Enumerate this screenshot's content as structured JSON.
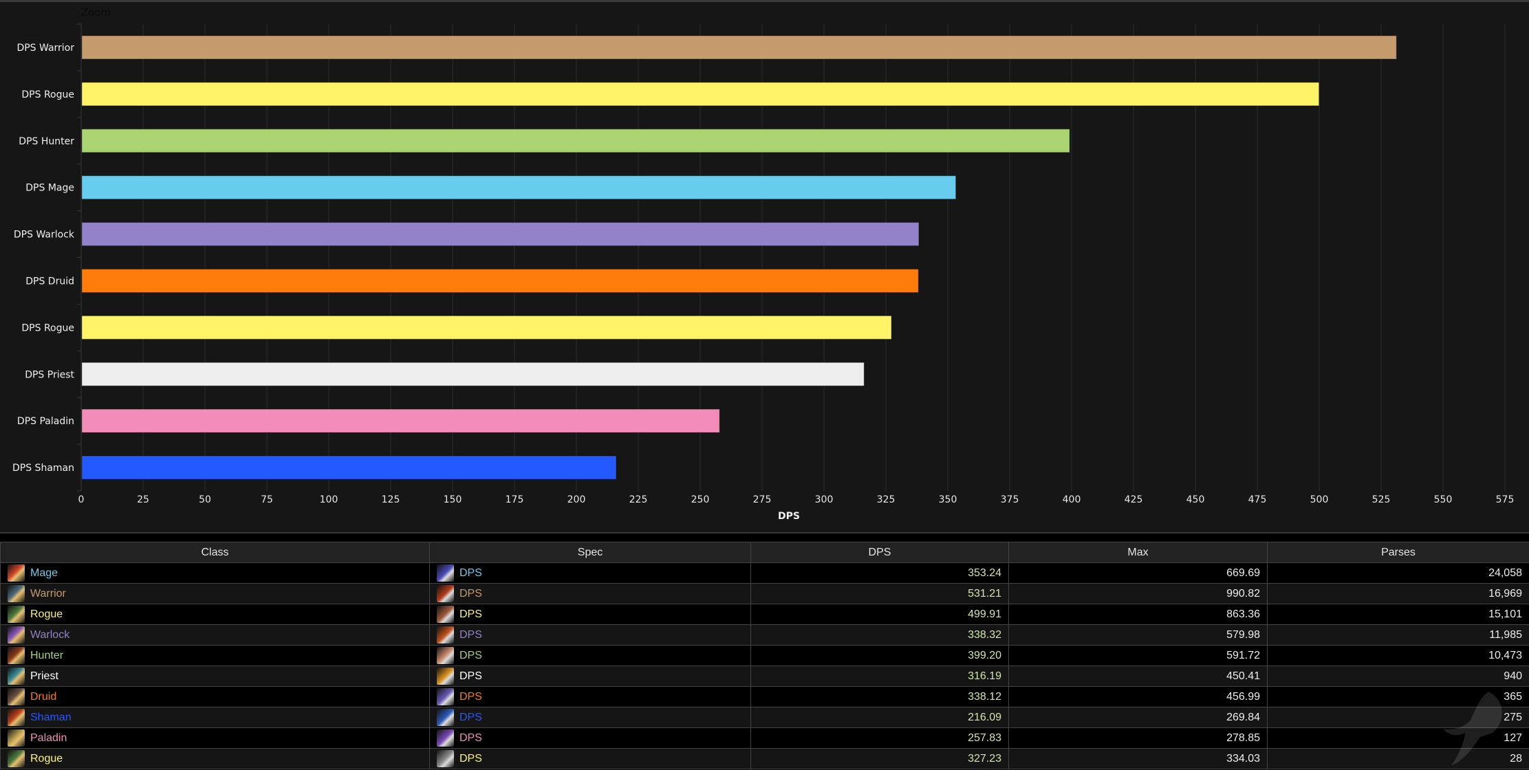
{
  "chart_data": {
    "type": "bar",
    "orientation": "horizontal",
    "zoom_label": "Zoom",
    "categories": [
      "DPS Warrior",
      "DPS Rogue",
      "DPS Hunter",
      "DPS Mage",
      "DPS Warlock",
      "DPS Druid",
      "DPS Rogue",
      "DPS Priest",
      "DPS Paladin",
      "DPS Shaman"
    ],
    "values": [
      531.21,
      499.91,
      399.2,
      353.24,
      338.32,
      338.12,
      327.23,
      316.19,
      257.83,
      216.09
    ],
    "colors": [
      "#C69B6D",
      "#FFF468",
      "#AAD372",
      "#68CCEF",
      "#9382C9",
      "#FF7C0A",
      "#FFF468",
      "#EEEEEE",
      "#F48CBA",
      "#2459FF"
    ],
    "xlabel": "DPS",
    "ylabel": "",
    "xlim": [
      0,
      575
    ],
    "xticks": [
      0,
      25,
      50,
      75,
      100,
      125,
      150,
      175,
      200,
      225,
      250,
      275,
      300,
      325,
      350,
      375,
      400,
      425,
      450,
      475,
      500,
      525,
      550,
      575
    ],
    "grid": true,
    "legend": "none"
  },
  "table": {
    "columns": [
      "Class",
      "Spec",
      "DPS",
      "Max",
      "Parses"
    ],
    "rows": [
      {
        "class": "Mage",
        "spec": "DPS",
        "dps": "353.24",
        "max": "669.69",
        "parses": "24,058",
        "color": "#68CCEF",
        "class_icon": "mage-class-icon",
        "spec_icon": "frost-spec-icon",
        "icon_colors": [
          "#d2452a",
          "#4a4ab8"
        ]
      },
      {
        "class": "Warrior",
        "spec": "DPS",
        "dps": "531.21",
        "max": "990.82",
        "parses": "16,969",
        "color": "#C69B6D",
        "class_icon": "warrior-class-icon",
        "spec_icon": "fury-spec-icon",
        "icon_colors": [
          "#4a6a7a",
          "#b33a1a"
        ]
      },
      {
        "class": "Rogue",
        "spec": "DPS",
        "dps": "499.91",
        "max": "863.36",
        "parses": "15,101",
        "color": "#FFF468",
        "class_icon": "rogue-class-icon",
        "spec_icon": "combat-spec-icon",
        "icon_colors": [
          "#4a7a3a",
          "#a05a3a"
        ]
      },
      {
        "class": "Warlock",
        "spec": "DPS",
        "dps": "338.32",
        "max": "579.98",
        "parses": "11,985",
        "color": "#9382C9",
        "class_icon": "warlock-class-icon",
        "spec_icon": "destruction-spec-icon",
        "icon_colors": [
          "#8a5ab8",
          "#c0501a"
        ]
      },
      {
        "class": "Hunter",
        "spec": "DPS",
        "dps": "399.20",
        "max": "591.72",
        "parses": "10,473",
        "color": "#AAD372",
        "class_icon": "hunter-class-icon",
        "spec_icon": "marksmanship-spec-icon",
        "icon_colors": [
          "#8a3a1a",
          "#c88a6a"
        ]
      },
      {
        "class": "Priest",
        "spec": "DPS",
        "dps": "316.19",
        "max": "450.41",
        "parses": "940",
        "color": "#FFFFFF",
        "class_icon": "priest-class-icon",
        "spec_icon": "shadow-spec-icon",
        "icon_colors": [
          "#3a8a9a",
          "#d8901a"
        ]
      },
      {
        "class": "Druid",
        "spec": "DPS",
        "dps": "338.12",
        "max": "456.99",
        "parses": "365",
        "color": "#FF7C0A",
        "class_icon": "druid-class-icon",
        "spec_icon": "balance-spec-icon",
        "icon_colors": [
          "#6a5040",
          "#6a5ab8"
        ]
      },
      {
        "class": "Shaman",
        "spec": "DPS",
        "dps": "216.09",
        "max": "269.84",
        "parses": "275",
        "color": "#2459FF",
        "class_icon": "shaman-class-icon",
        "spec_icon": "elemental-spec-icon",
        "icon_colors": [
          "#b8401a",
          "#2a5ab8"
        ]
      },
      {
        "class": "Paladin",
        "spec": "DPS",
        "dps": "257.83",
        "max": "278.85",
        "parses": "127",
        "color": "#F48CBA",
        "class_icon": "paladin-class-icon",
        "spec_icon": "retribution-spec-icon",
        "icon_colors": [
          "#b8a050",
          "#7a4ab8"
        ]
      },
      {
        "class": "Rogue",
        "spec": "DPS",
        "dps": "327.23",
        "max": "334.03",
        "parses": "28",
        "color": "#FFF468",
        "class_icon": "rogue-class-icon",
        "spec_icon": "subtlety-spec-icon",
        "icon_colors": [
          "#4a7a3a",
          "#8a8a8a"
        ]
      }
    ]
  }
}
